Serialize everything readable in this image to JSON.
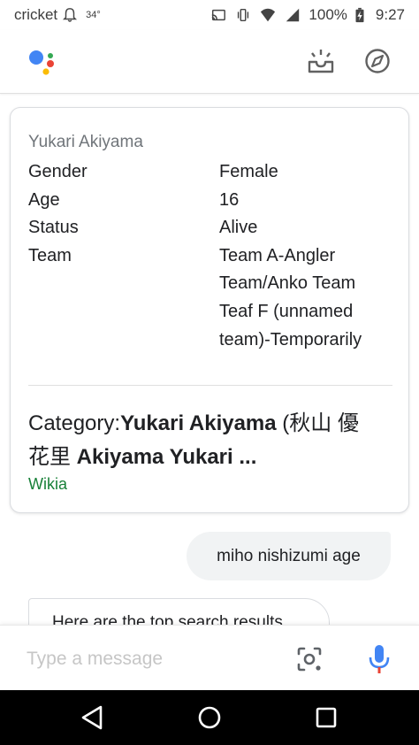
{
  "status_bar": {
    "carrier": "cricket",
    "temperature": "34°",
    "battery": "100%",
    "time": "9:27"
  },
  "top_bar": {
    "logo_icon": "google-assistant-dots-icon",
    "actions": [
      "snapshot-inbox-icon",
      "explore-compass-icon"
    ]
  },
  "card": {
    "title": "Yukari Akiyama",
    "rows": [
      {
        "key": "Gender",
        "value": "Female"
      },
      {
        "key": "Age",
        "value": "16"
      },
      {
        "key": "Status",
        "value": "Alive"
      },
      {
        "key": "Team",
        "value": "Team A-Angler"
      },
      {
        "key": "",
        "value": "Team/Anko Team"
      },
      {
        "key": "",
        "value": "Teaf F (unnamed"
      },
      {
        "key": "",
        "value": "team)-Temporarily"
      }
    ],
    "result": {
      "prefix": "Category:",
      "title_bold_1": "Yukari Akiyama",
      "title_plain": " (秋山 優",
      "title_line2_plain": "花里 ",
      "title_bold_2": "Akiyama Yukari ...",
      "source": "Wikia"
    }
  },
  "chat": {
    "user_message": "miho nishizumi age",
    "assistant_message": "Here are the top search results"
  },
  "input": {
    "placeholder": "Type a message",
    "value": ""
  },
  "colors": {
    "link_green": "#188038",
    "mic_blue": "#4285f4",
    "mic_red": "#ea4335"
  }
}
